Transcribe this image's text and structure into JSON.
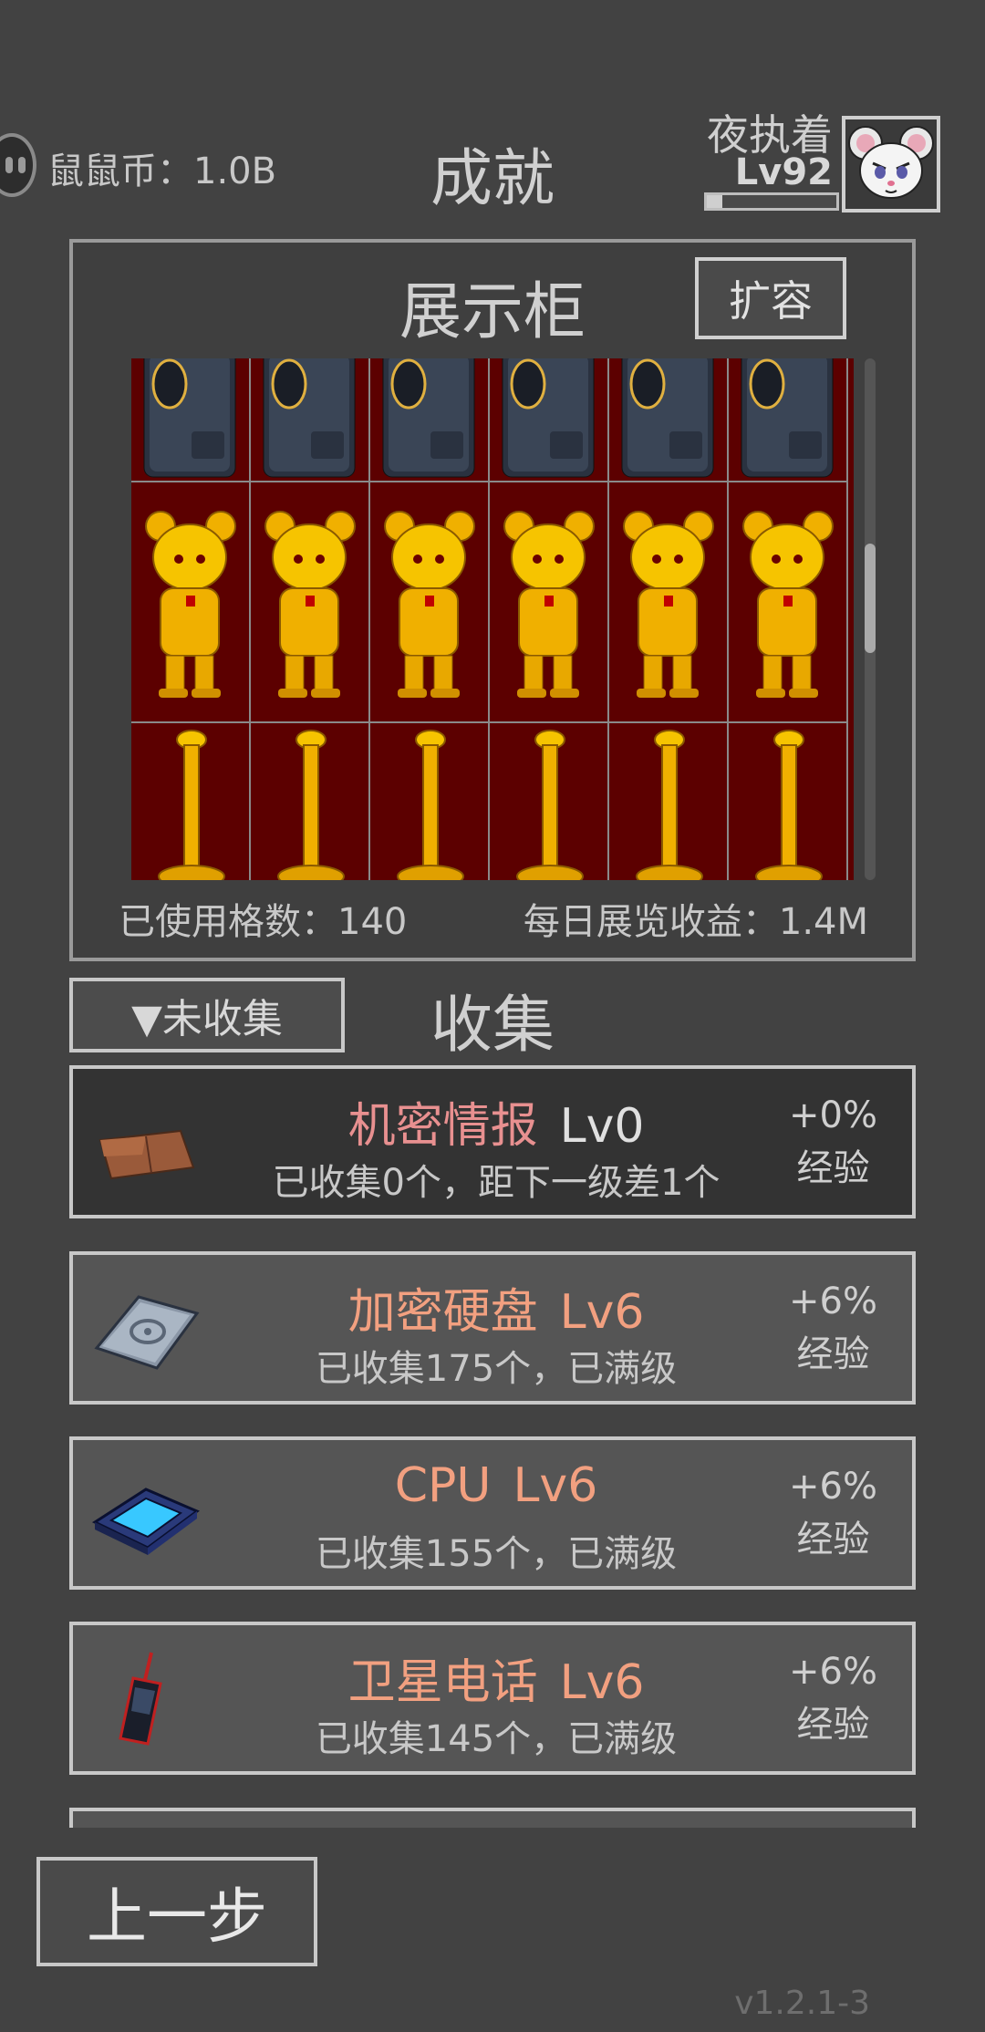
{
  "header": {
    "coin_text": "鼠鼠币：1.0B",
    "title": "成就",
    "user_name": "夜执着",
    "user_level": "Lv92",
    "xp_progress": 0.12
  },
  "showcase": {
    "title": "展示柜",
    "expand_label": "扩容",
    "used_cells": "已使用格数：140",
    "daily_income": "每日展览收益：1.4M",
    "rows": [
      {
        "item": "safe-door-icon",
        "count": 6
      },
      {
        "item": "golden-mouse-statue-icon",
        "count": 6
      },
      {
        "item": "golden-stanchion-icon",
        "count": 6
      }
    ],
    "scroll_position": 0.45
  },
  "collection": {
    "filter_label": "▼未收集",
    "title": "收集",
    "items": [
      {
        "icon": "document-folder-icon",
        "name": "机密情报",
        "level": "Lv0",
        "desc": "已收集0个，距下一级差1个",
        "bonus": "+0%",
        "bonus_label": "经验",
        "locked": true
      },
      {
        "icon": "hard-drive-icon",
        "name": "加密硬盘",
        "level": "Lv6",
        "desc": "已收集175个，已满级",
        "bonus": "+6%",
        "bonus_label": "经验",
        "locked": false
      },
      {
        "icon": "cpu-chip-icon",
        "name": "CPU",
        "level": "Lv6",
        "desc": "已收集155个，已满级",
        "bonus": "+6%",
        "bonus_label": "经验",
        "locked": false
      },
      {
        "icon": "satellite-phone-icon",
        "name": "卫星电话",
        "level": "Lv6",
        "desc": "已收集145个，已满级",
        "bonus": "+6%",
        "bonus_label": "经验",
        "locked": false
      }
    ]
  },
  "footer": {
    "back_label": "上一步",
    "version": "v1.2.1-3"
  },
  "colors": {
    "background": "#424242",
    "showcase_cell": "#5c0000",
    "item_name": "#f2a080",
    "locked_name": "#e89090"
  }
}
